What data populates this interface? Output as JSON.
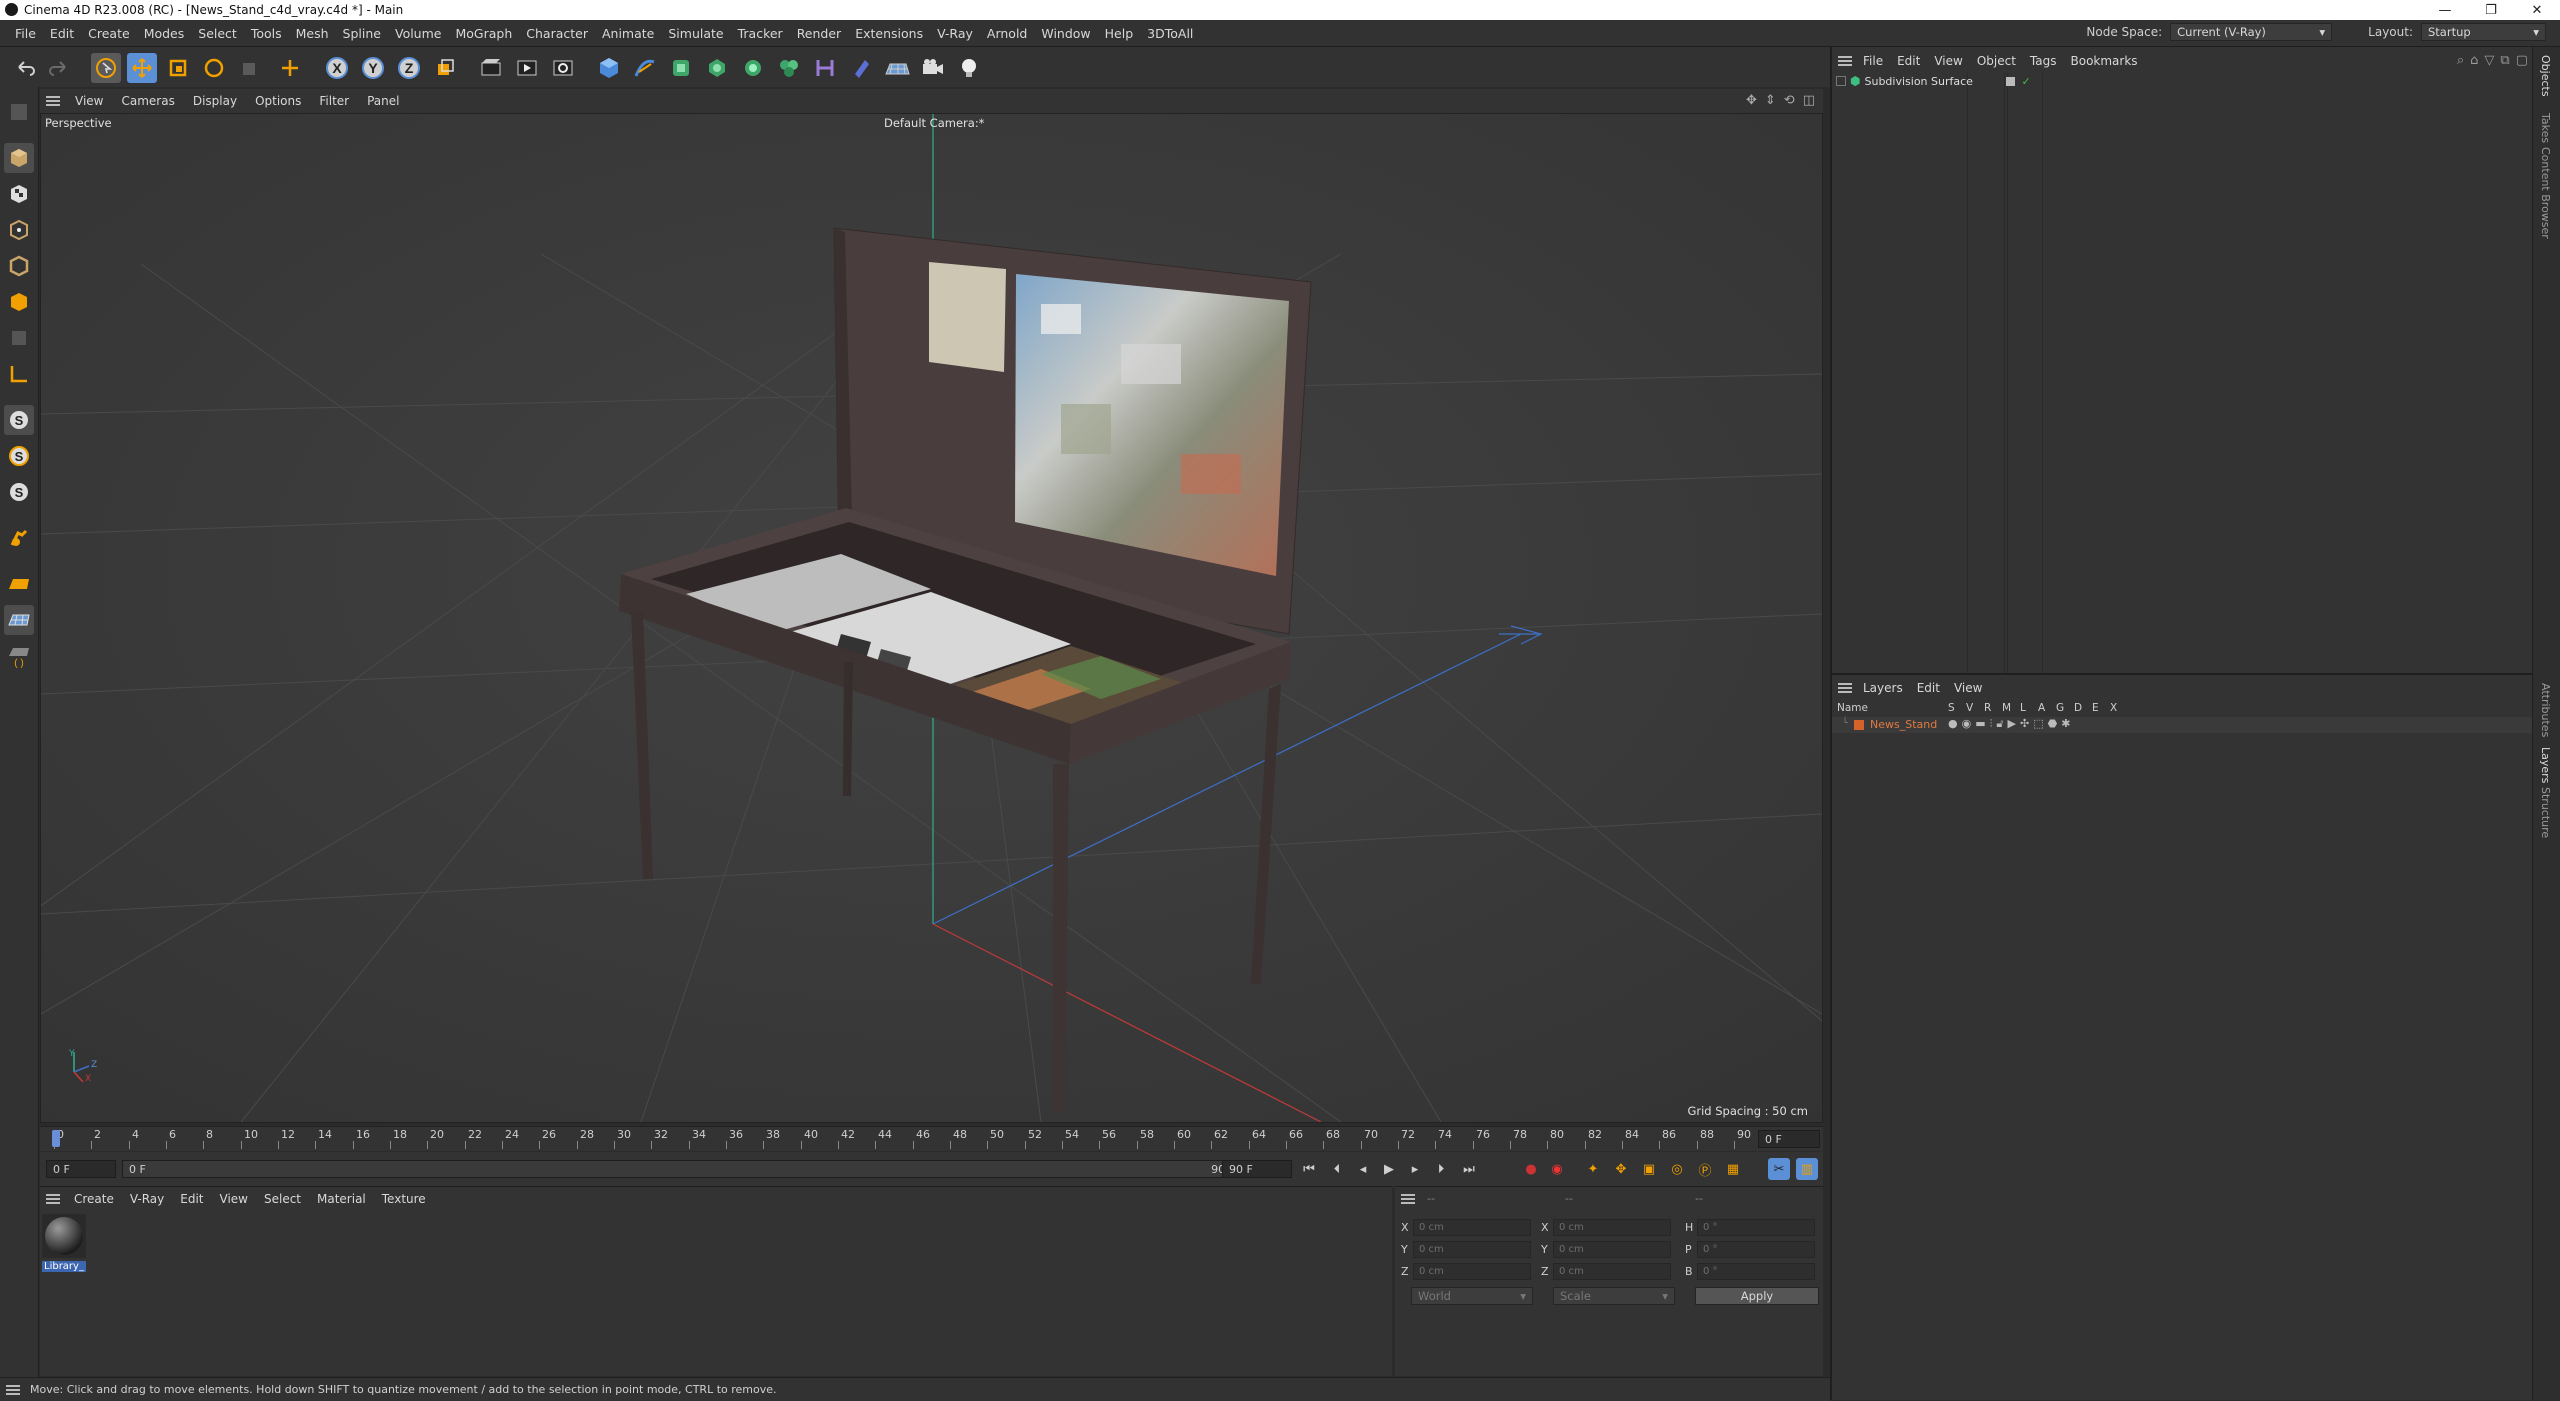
{
  "window": {
    "title": "Cinema 4D R23.008 (RC) - [News_Stand_c4d_vray.c4d *] - Main",
    "controls": [
      "—",
      "❐",
      "✕"
    ]
  },
  "menubar": {
    "items": [
      "File",
      "Edit",
      "Create",
      "Modes",
      "Select",
      "Tools",
      "Mesh",
      "Spline",
      "Volume",
      "MoGraph",
      "Character",
      "Animate",
      "Simulate",
      "Tracker",
      "Render",
      "Extensions",
      "V-Ray",
      "Arnold",
      "Window",
      "Help",
      "3DToAll"
    ],
    "node_space_label": "Node Space:",
    "node_space_value": "Current (V-Ray)",
    "layout_label": "Layout:",
    "layout_value": "Startup"
  },
  "viewport": {
    "menu": [
      "View",
      "Cameras",
      "Display",
      "Options",
      "Filter",
      "Panel"
    ],
    "view_name": "Perspective",
    "camera_name": "Default Camera",
    "camera_suffix": ":*",
    "grid_spacing": "Grid Spacing : 50 cm",
    "axis": {
      "y": "Y",
      "z": "Z",
      "x": "X"
    }
  },
  "timeline": {
    "ticks": [
      "0",
      "2",
      "4",
      "6",
      "8",
      "10",
      "12",
      "14",
      "16",
      "18",
      "20",
      "22",
      "24",
      "26",
      "28",
      "30",
      "32",
      "34",
      "36",
      "38",
      "40",
      "42",
      "44",
      "46",
      "48",
      "50",
      "52",
      "54",
      "56",
      "58",
      "60",
      "62",
      "64",
      "66",
      "68",
      "70",
      "72",
      "74",
      "76",
      "78",
      "80",
      "82",
      "84",
      "86",
      "88",
      "90"
    ],
    "current_frame": "0 F",
    "start_frame": "0 F",
    "range_start": "0 F",
    "range_end": "90 F",
    "end_frame": "90 F"
  },
  "materials": {
    "menu": [
      "Create",
      "V-Ray",
      "Edit",
      "View",
      "Select",
      "Material",
      "Texture"
    ],
    "items": [
      {
        "label": "Library_"
      }
    ]
  },
  "coordinates": {
    "header1": "--",
    "header2": "--",
    "header3": "--",
    "rows": [
      {
        "a_label": "X",
        "a_value": "0 cm",
        "b_label": "X",
        "b_value": "0 cm",
        "c_label": "H",
        "c_value": "0 °"
      },
      {
        "a_label": "Y",
        "a_value": "0 cm",
        "b_label": "Y",
        "b_value": "0 cm",
        "c_label": "P",
        "c_value": "0 °"
      },
      {
        "a_label": "Z",
        "a_value": "0 cm",
        "b_label": "Z",
        "b_value": "0 cm",
        "c_label": "B",
        "c_value": "0 °"
      }
    ],
    "space": "World",
    "mode": "Scale",
    "apply": "Apply"
  },
  "objects": {
    "menu": [
      "File",
      "Edit",
      "View",
      "Object",
      "Tags",
      "Bookmarks"
    ],
    "items": [
      {
        "name": "Subdivision Surface"
      }
    ]
  },
  "layers": {
    "menu": [
      "Layers",
      "Edit",
      "View"
    ],
    "name_header": "Name",
    "columns": [
      "S",
      "V",
      "R",
      "M",
      "L",
      "A",
      "G",
      "D",
      "E",
      "X"
    ],
    "items": [
      {
        "name": "News_Stand",
        "color": "#d4622a"
      }
    ]
  },
  "side_tabs": [
    "Objects",
    "Takes",
    "Content Browser",
    "Attributes",
    "Layers",
    "Structure"
  ],
  "status": {
    "text": "Move: Click and drag to move elements. Hold down SHIFT to quantize movement / add to the selection in point mode, CTRL to remove."
  },
  "colors": {
    "accent_orange": "#f0a000",
    "accent_blue": "#5b8fd6",
    "layer_orange": "#d4622a",
    "check_green": "#3fbf3f"
  }
}
